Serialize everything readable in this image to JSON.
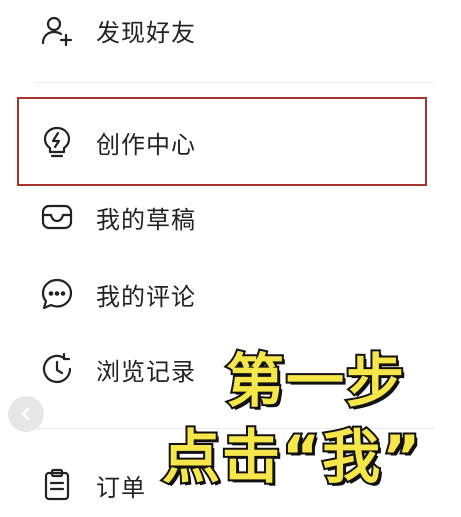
{
  "menu": {
    "items": [
      {
        "label": "发现好友",
        "icon": "add-friend-icon"
      },
      {
        "label": "创作中心",
        "icon": "lightning-icon"
      },
      {
        "label": "我的草稿",
        "icon": "drafts-icon"
      },
      {
        "label": "我的评论",
        "icon": "comment-icon"
      },
      {
        "label": "浏览记录",
        "icon": "history-icon"
      },
      {
        "label": "订单",
        "icon": "order-icon"
      }
    ]
  },
  "overlay": {
    "line1": "第一步",
    "line2": "点击“我”"
  },
  "colors": {
    "highlight_border": "#a5352b",
    "overlay_fill": "#f6e64a",
    "overlay_stroke": "#111111",
    "label_text": "#222222"
  }
}
